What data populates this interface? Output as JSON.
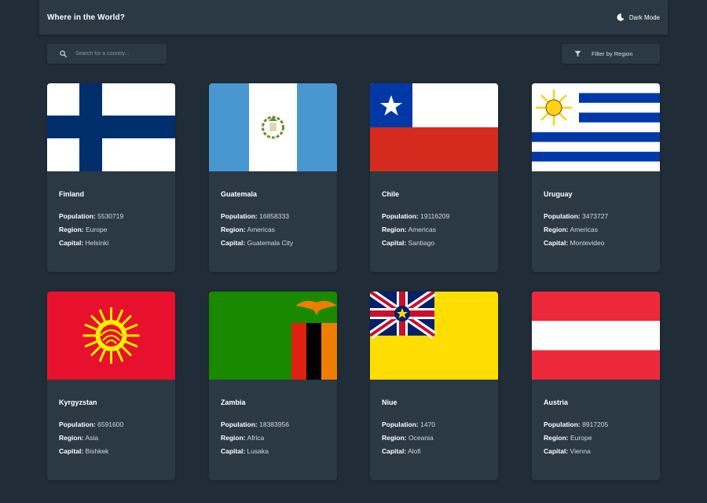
{
  "header": {
    "title": "Where in the World?",
    "theme_label": "Dark Mode"
  },
  "search": {
    "placeholder": "Search for a country..."
  },
  "filter": {
    "label": "Filter by Region"
  },
  "labels": {
    "population": "Population:",
    "region": "Region:",
    "capital": "Capital:"
  },
  "countries": [
    {
      "name": "Finland",
      "population": "5530719",
      "region": "Europe",
      "capital": "Helsinki"
    },
    {
      "name": "Guatemala",
      "population": "16858333",
      "region": "Americas",
      "capital": "Guatemala City"
    },
    {
      "name": "Chile",
      "population": "19116209",
      "region": "Americas",
      "capital": "Santiago"
    },
    {
      "name": "Uruguay",
      "population": "3473727",
      "region": "Americas",
      "capital": "Montevideo"
    },
    {
      "name": "Kyrgyzstan",
      "population": "6591600",
      "region": "Asia",
      "capital": "Bishkek"
    },
    {
      "name": "Zambia",
      "population": "18383956",
      "region": "Africa",
      "capital": "Lusaka"
    },
    {
      "name": "Niue",
      "population": "1470",
      "region": "Oceania",
      "capital": "Alofi"
    },
    {
      "name": "Austria",
      "population": "8917205",
      "region": "Europe",
      "capital": "Vienna"
    }
  ],
  "colors": {
    "background": "#202c37",
    "element": "#2b3945",
    "text": "#ffffff"
  }
}
